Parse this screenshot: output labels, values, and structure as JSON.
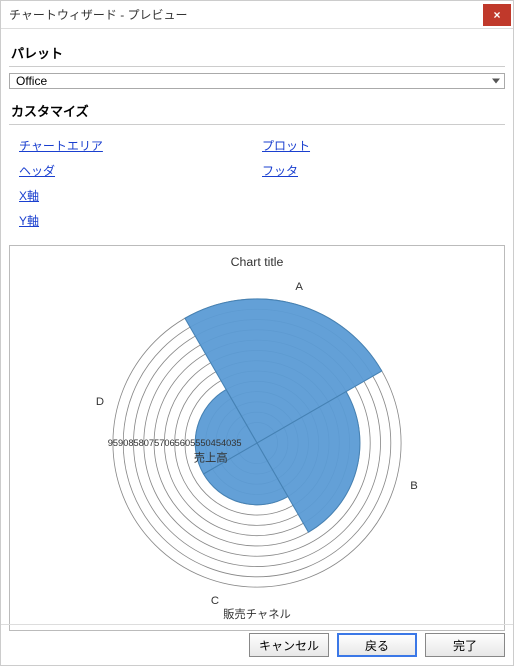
{
  "window": {
    "title": "チャートウィザード - プレビュー"
  },
  "palette": {
    "label": "パレット",
    "value": "Office"
  },
  "customize": {
    "label": "カスタマイズ",
    "links_left": [
      "チャートエリア",
      "ヘッダ",
      "X軸",
      "Y軸"
    ],
    "links_right": [
      "プロット",
      "フッタ"
    ]
  },
  "buttons": {
    "cancel": "キャンセル",
    "back": "戻る",
    "finish": "完了"
  },
  "chart_data": {
    "type": "polar-area",
    "title": "Chart title",
    "categories": [
      "A",
      "B",
      "C",
      "D"
    ],
    "values": [
      95,
      75,
      55,
      55
    ],
    "axis_label": "売上高",
    "footer_label": "販売チャネル",
    "ticks": [
      35,
      40,
      45,
      50,
      55,
      60,
      65,
      70,
      75,
      80,
      85,
      90,
      95
    ],
    "fill": "#5b9bd5",
    "stroke": "#4682b4",
    "angle_offset_deg": -120
  }
}
